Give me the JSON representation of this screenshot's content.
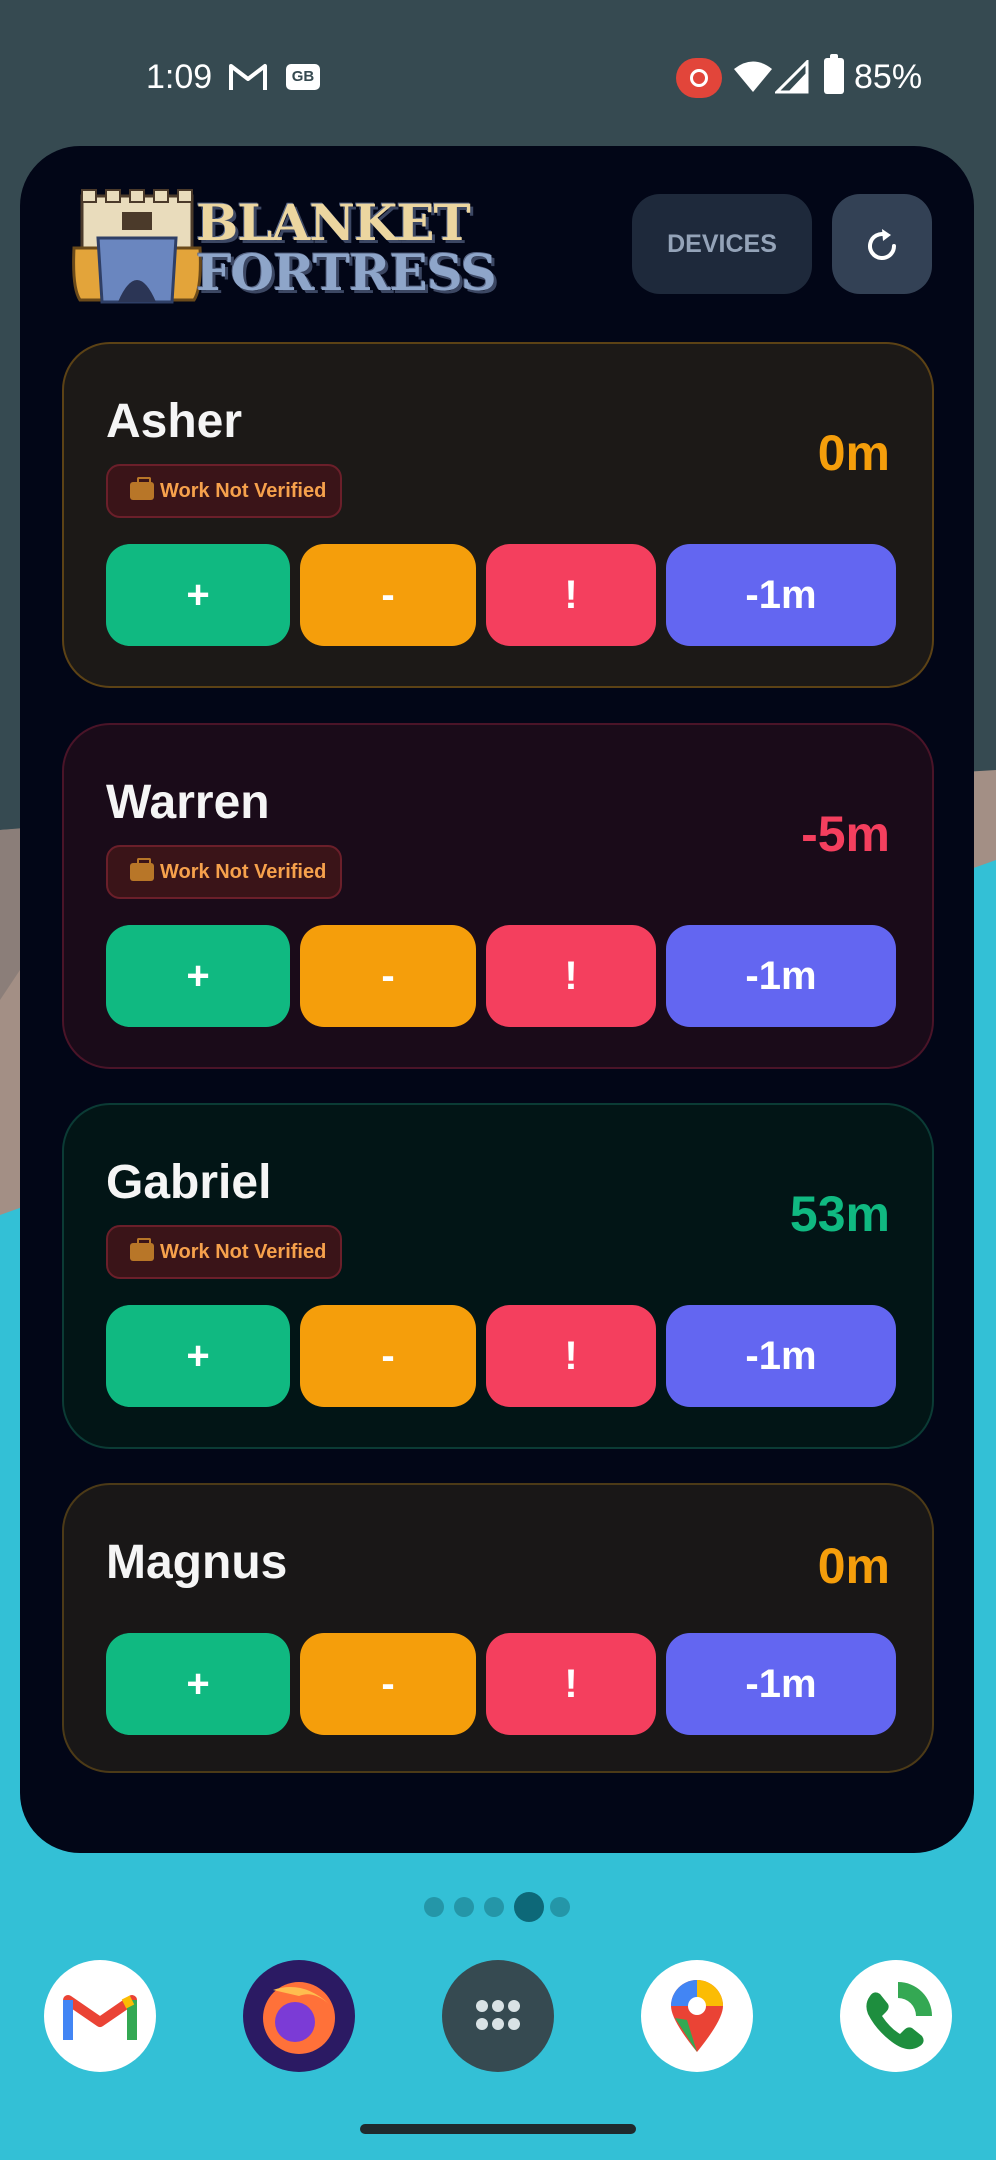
{
  "status_bar": {
    "time": "1:09",
    "gb_badge": "GB",
    "battery": "85%",
    "icons": [
      "gmail-icon",
      "gb-icon",
      "screen-record-icon",
      "wifi-icon",
      "signal-icon",
      "battery-icon"
    ]
  },
  "widget": {
    "logo": {
      "line1": "BLANKET",
      "line2": "FORTRESS"
    },
    "devices_label": "DEVICES",
    "refresh_icon": "refresh-icon",
    "kids": [
      {
        "name": "Asher",
        "time": "0m",
        "time_color": "#f59e0b",
        "badge": "Work Not Verified",
        "theme": "orange",
        "top": 0
      },
      {
        "name": "Warren",
        "time": "-5m",
        "time_color": "#f43f5e",
        "badge": "Work Not Verified",
        "theme": "red"
      },
      {
        "name": "Gabriel",
        "time": "53m",
        "time_color": "#10b981",
        "badge": "Work Not Verified",
        "theme": "green"
      },
      {
        "name": "Magnus",
        "time": "0m",
        "time_color": "#f59e0b",
        "badge": "",
        "theme": "neutral"
      }
    ],
    "buttons": {
      "plus": "+",
      "minus": "-",
      "alert": "!",
      "dec": "-1m"
    }
  },
  "home": {
    "page_count": 5,
    "active_page": 4,
    "dock": [
      "gmail-icon",
      "firefox-icon",
      "app-drawer-icon",
      "maps-icon",
      "phone-icon"
    ]
  }
}
